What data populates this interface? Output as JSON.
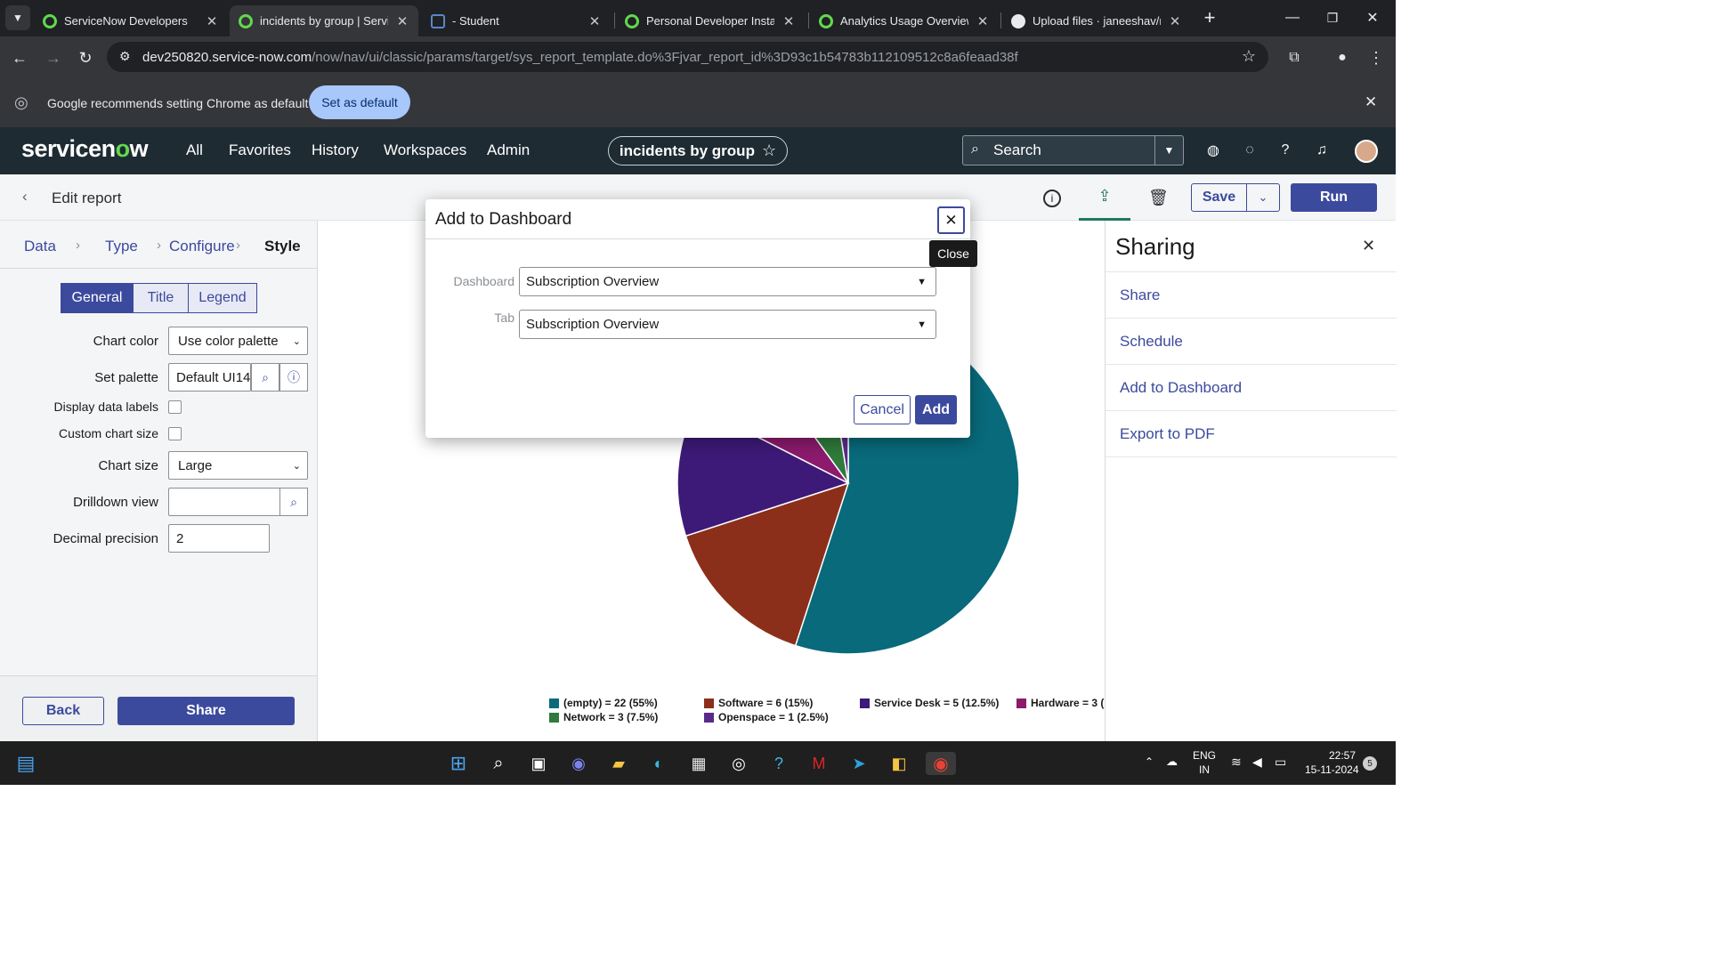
{
  "browser": {
    "tabs": [
      {
        "title": "ServiceNow Developers",
        "active": false
      },
      {
        "title": "incidents by group | Servic",
        "active": true
      },
      {
        "title": "- Student",
        "active": false
      },
      {
        "title": "Personal Developer Instanc",
        "active": false
      },
      {
        "title": "Analytics Usage Overview |",
        "active": false
      },
      {
        "title": "Upload files · janeeshav/na",
        "active": false
      }
    ],
    "url_host": "dev250820.service-now.com",
    "url_path": "/now/nav/ui/classic/params/target/sys_report_template.do%3Fjvar_report_id%3D93c1b54783b112109512c8a6feaad38f",
    "infobar_text": "Google recommends setting Chrome as default",
    "infobar_button": "Set as default"
  },
  "header": {
    "logo_pre": "servicen",
    "logo_o": "o",
    "logo_post": "w",
    "nav": [
      "All",
      "Favorites",
      "History",
      "Workspaces",
      "Admin"
    ],
    "title": "incidents by group",
    "search_label": "Search"
  },
  "report": {
    "back_label": "Edit report",
    "save_label": "Save",
    "run_label": "Run"
  },
  "left": {
    "steps": [
      "Data",
      "Type",
      "Configure",
      "Style"
    ],
    "seg": [
      "General",
      "Title",
      "Legend"
    ],
    "chart_color_label": "Chart color",
    "chart_color_value": "Use color palette",
    "set_palette_label": "Set palette",
    "set_palette_value": "Default UI14",
    "display_labels_label": "Display data labels",
    "custom_size_label": "Custom chart size",
    "chart_size_label": "Chart size",
    "chart_size_value": "Large",
    "drilldown_label": "Drilldown view",
    "drilldown_value": "",
    "decimal_label": "Decimal precision",
    "decimal_value": "2",
    "back_button": "Back",
    "share_button": "Share"
  },
  "sharing": {
    "title": "Sharing",
    "items": [
      "Share",
      "Schedule",
      "Add to Dashboard",
      "Export to PDF"
    ]
  },
  "modal": {
    "title": "Add to Dashboard",
    "close_tooltip": "Close",
    "dashboard_label": "Dashboard",
    "dashboard_value": "Subscription Overview",
    "tab_label": "Tab",
    "tab_value": "Subscription Overview",
    "cancel": "Cancel",
    "add": "Add"
  },
  "chart_data": {
    "type": "pie",
    "slices": [
      {
        "label": "(empty) = 22 (55%)",
        "name": "(empty)",
        "value": 22,
        "color": "#086a7b"
      },
      {
        "label": "Software = 6 (15%)",
        "name": "Software",
        "value": 6,
        "color": "#8c2f1a"
      },
      {
        "label": "Service Desk = 5 (12.5%)",
        "name": "Service Desk",
        "value": 5,
        "color": "#3d1a78"
      },
      {
        "label": "Hardware = 3 (",
        "name": "Hardware",
        "value": 3,
        "color": "#8c1a6d"
      },
      {
        "label": "Network = 3 (7.5%)",
        "name": "Network",
        "value": 3,
        "color": "#2f7a3c"
      },
      {
        "label": "Openspace = 1 (2.5%)",
        "name": "Openspace",
        "value": 1,
        "color": "#5a2a8a"
      }
    ]
  },
  "taskbar": {
    "lang": "ENG",
    "region": "IN",
    "time": "22:57",
    "date": "15-11-2024",
    "badge": "5"
  }
}
